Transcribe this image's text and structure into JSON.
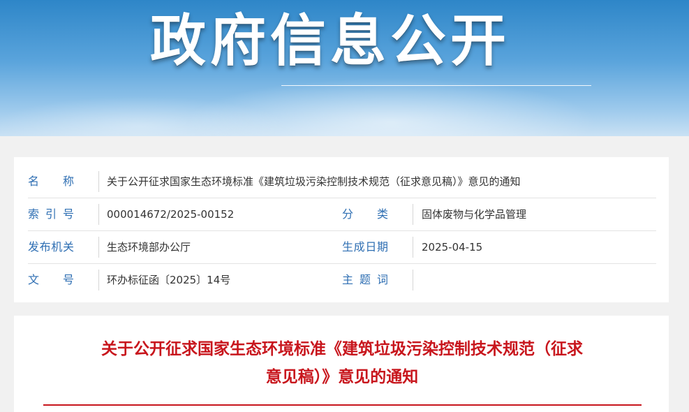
{
  "banner": {
    "title": "政府信息公开"
  },
  "info": {
    "name_label": "名称",
    "name_value": "关于公开征求国家生态环境标准《建筑垃圾污染控制技术规范（征求意见稿）》意见的通知",
    "index_label": "索引号",
    "index_value": "000014672/2025-00152",
    "category_label": "分类",
    "category_value": "固体废物与化学品管理",
    "issuer_label": "发布机关",
    "issuer_value": "生态环境部办公厅",
    "date_label": "生成日期",
    "date_value": "2025-04-15",
    "docno_label": "文号",
    "docno_value": "环办标征函〔2025〕14号",
    "subject_label": "主题词",
    "subject_value": ""
  },
  "document": {
    "title_line1": "关于公开征求国家生态环境标准《建筑垃圾污染控制技术规范（征求",
    "title_line2": "意见稿）》意见的通知"
  },
  "colors": {
    "label_blue": "#2f6fb3",
    "title_red": "#c8161d"
  }
}
